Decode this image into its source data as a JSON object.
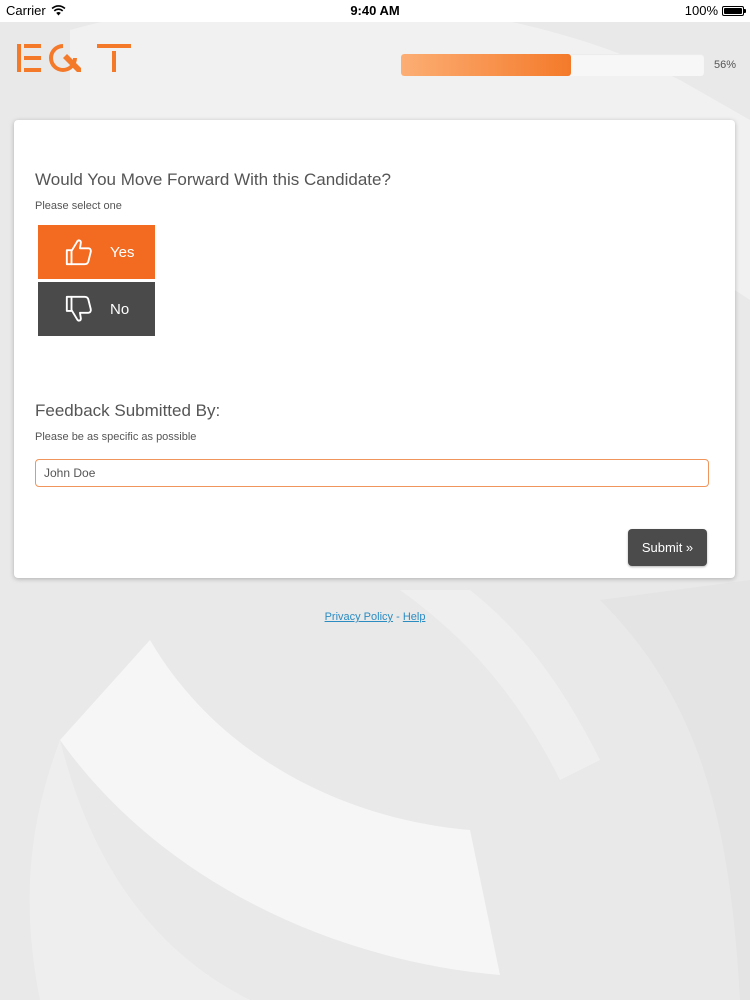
{
  "status_bar": {
    "carrier": "Carrier",
    "time": "9:40 AM",
    "battery": "100%"
  },
  "header": {
    "logo_text": "EQT",
    "progress_percent": 56,
    "progress_label": "56%"
  },
  "question": {
    "title": "Would You Move Forward With this Candidate?",
    "hint": "Please select one",
    "options": [
      {
        "label": "Yes",
        "icon": "thumbs-up-icon"
      },
      {
        "label": "No",
        "icon": "thumbs-down-icon"
      }
    ]
  },
  "feedback": {
    "title": "Feedback Submitted By:",
    "hint": "Please be as specific as possible",
    "input_value": "John Doe"
  },
  "submit": {
    "label": "Submit »"
  },
  "footer": {
    "privacy_label": "Privacy Policy",
    "separator": " - ",
    "help_label": "Help"
  },
  "colors": {
    "accent": "#f26b21",
    "dark_button": "#4a4a4a",
    "link": "#2b8cc2",
    "background": "#e9e9e9"
  }
}
